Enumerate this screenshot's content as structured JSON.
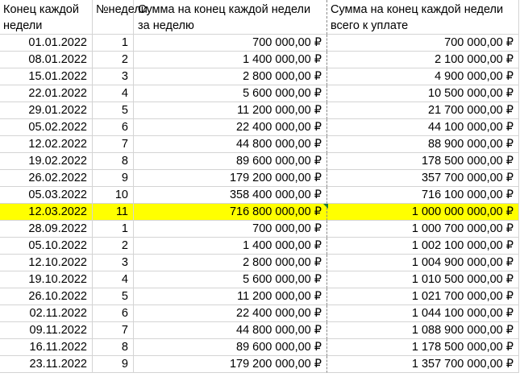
{
  "headers": {
    "col_a": "Конец каждой недели",
    "col_b": "№недели",
    "col_c": "Сумма на конец каждой недели за неделю",
    "col_d": "Сумма на конец каждой недели всего к уплате"
  },
  "highlight_color": "#ffff00",
  "rows": [
    {
      "date": "01.01.2022",
      "week": "1",
      "sum": "700 000,00 ₽",
      "total": "700 000,00 ₽"
    },
    {
      "date": "08.01.2022",
      "week": "2",
      "sum": "1 400 000,00 ₽",
      "total": "2 100 000,00 ₽"
    },
    {
      "date": "15.01.2022",
      "week": "3",
      "sum": "2 800 000,00 ₽",
      "total": "4 900 000,00 ₽"
    },
    {
      "date": "22.01.2022",
      "week": "4",
      "sum": "5 600 000,00 ₽",
      "total": "10 500 000,00 ₽"
    },
    {
      "date": "29.01.2022",
      "week": "5",
      "sum": "11 200 000,00 ₽",
      "total": "21 700 000,00 ₽"
    },
    {
      "date": "05.02.2022",
      "week": "6",
      "sum": "22 400 000,00 ₽",
      "total": "44 100 000,00 ₽"
    },
    {
      "date": "12.02.2022",
      "week": "7",
      "sum": "44 800 000,00 ₽",
      "total": "88 900 000,00 ₽"
    },
    {
      "date": "19.02.2022",
      "week": "8",
      "sum": "89 600 000,00 ₽",
      "total": "178 500 000,00 ₽"
    },
    {
      "date": "26.02.2022",
      "week": "9",
      "sum": "179 200 000,00 ₽",
      "total": "357 700 000,00 ₽"
    },
    {
      "date": "05.03.2022",
      "week": "10",
      "sum": "358 400 000,00 ₽",
      "total": "716 100 000,00 ₽"
    },
    {
      "date": "12.03.2022",
      "week": "11",
      "sum": "716 800 000,00 ₽",
      "total": "1 000 000 000,00 ₽",
      "highlighted": true
    },
    {
      "date": "28.09.2022",
      "week": "1",
      "sum": "700 000,00 ₽",
      "total": "1 000 700 000,00 ₽"
    },
    {
      "date": "05.10.2022",
      "week": "2",
      "sum": "1 400 000,00 ₽",
      "total": "1 002 100 000,00 ₽"
    },
    {
      "date": "12.10.2022",
      "week": "3",
      "sum": "2 800 000,00 ₽",
      "total": "1 004 900 000,00 ₽"
    },
    {
      "date": "19.10.2022",
      "week": "4",
      "sum": "5 600 000,00 ₽",
      "total": "1 010 500 000,00 ₽"
    },
    {
      "date": "26.10.2022",
      "week": "5",
      "sum": "11 200 000,00 ₽",
      "total": "1 021 700 000,00 ₽"
    },
    {
      "date": "02.11.2022",
      "week": "6",
      "sum": "22 400 000,00 ₽",
      "total": "1 044 100 000,00 ₽"
    },
    {
      "date": "09.11.2022",
      "week": "7",
      "sum": "44 800 000,00 ₽",
      "total": "1 088 900 000,00 ₽"
    },
    {
      "date": "16.11.2022",
      "week": "8",
      "sum": "89 600 000,00 ₽",
      "total": "1 178 500 000,00 ₽"
    },
    {
      "date": "23.11.2022",
      "week": "9",
      "sum": "179 200 000,00 ₽",
      "total": "1 357 700 000,00 ₽"
    }
  ]
}
